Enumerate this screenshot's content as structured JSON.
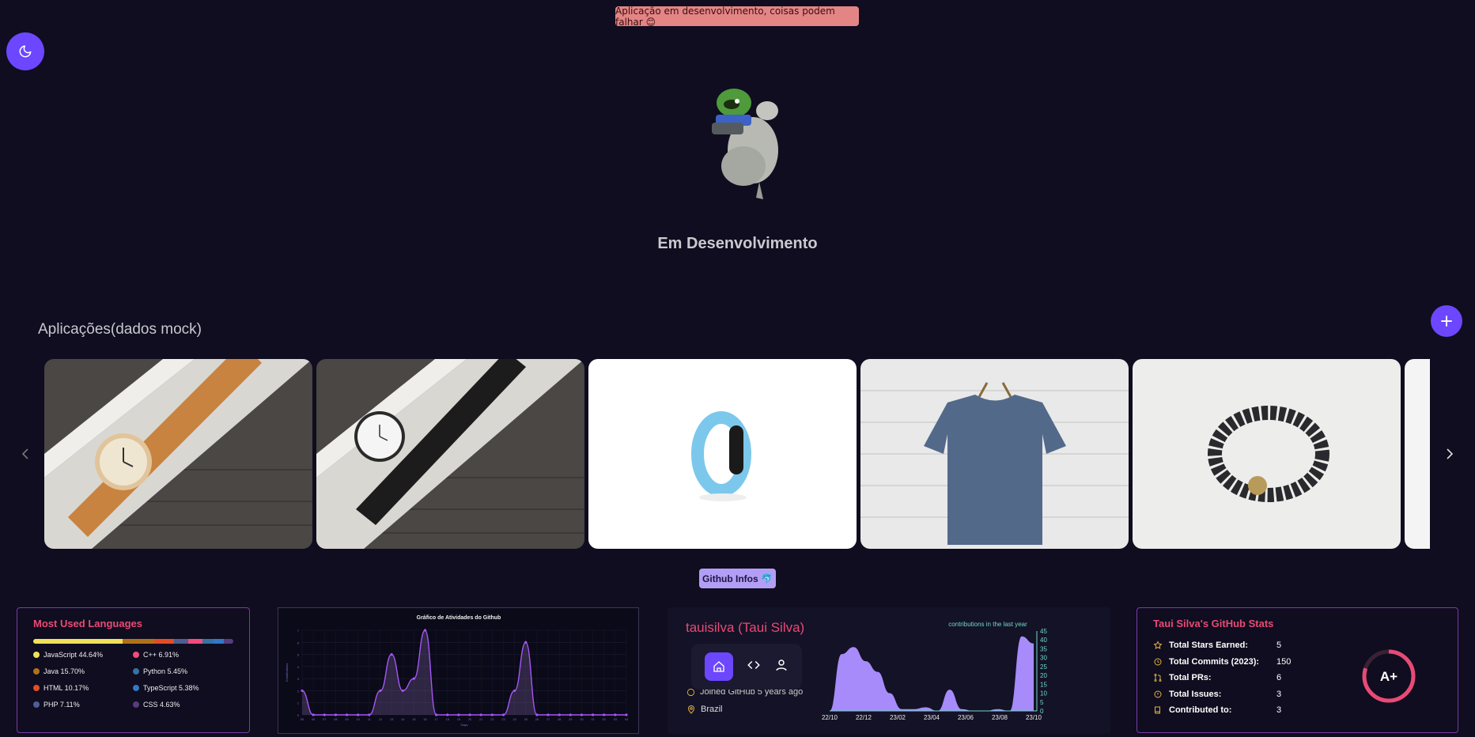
{
  "banner": {
    "text": "Aplicação em desenvolvimento, coisas podem falhar 😊"
  },
  "hero": {
    "title": "Em Desenvolvimento"
  },
  "apps": {
    "title": "Aplicações(dados mock)"
  },
  "github_badge": "Github Infos 🐬",
  "languages": {
    "title": "Most Used Languages",
    "items": [
      {
        "label": "JavaScript 44.64%",
        "color": "#f1e05a",
        "pct": 44.64
      },
      {
        "label": "C++ 6.91%",
        "color": "#f34b7d",
        "pct": 6.91
      },
      {
        "label": "Java 15.70%",
        "color": "#b07219",
        "pct": 15.7
      },
      {
        "label": "Python 5.45%",
        "color": "#3572A5",
        "pct": 5.45
      },
      {
        "label": "HTML 10.17%",
        "color": "#e34c26",
        "pct": 10.17
      },
      {
        "label": "TypeScript 5.38%",
        "color": "#3178c6",
        "pct": 5.38
      },
      {
        "label": "PHP 7.11%",
        "color": "#4F5D95",
        "pct": 7.11
      },
      {
        "label": "CSS 4.63%",
        "color": "#563d7c",
        "pct": 4.63
      }
    ]
  },
  "chart_data": [
    {
      "type": "area",
      "title": "Gráfico de Atividades do Github",
      "xlabel": "Days",
      "ylabel": "Contributions",
      "x": [
        "05",
        "06",
        "07",
        "08",
        "09",
        "10",
        "11",
        "12",
        "13",
        "14",
        "15",
        "16",
        "17",
        "18",
        "19",
        "20",
        "21",
        "22",
        "23",
        "24",
        "25",
        "26",
        "27",
        "28",
        "29",
        "30",
        "01",
        "02",
        "03",
        "04"
      ],
      "values": [
        2,
        0,
        0,
        0,
        0,
        0,
        0,
        2,
        5,
        2,
        3,
        7,
        0,
        0,
        0,
        0,
        0,
        0,
        0,
        2,
        6,
        0,
        0,
        0,
        0,
        0,
        0,
        0,
        0,
        0
      ],
      "ylim": [
        0,
        7
      ],
      "color": "#a855f7"
    },
    {
      "type": "area",
      "title": "contributions in the last year",
      "x": [
        "22/10",
        "22/12",
        "23/02",
        "23/04",
        "23/06",
        "23/08",
        "23/10"
      ],
      "values": [
        0,
        32,
        36,
        28,
        22,
        10,
        1,
        1,
        2,
        0,
        12,
        1,
        0,
        0,
        1,
        0,
        42,
        38
      ],
      "ylim": [
        0,
        45
      ],
      "yticks": [
        0,
        5,
        10,
        15,
        20,
        25,
        30,
        35,
        40,
        45
      ],
      "color": "#a78bfa"
    }
  ],
  "profile": {
    "name": "tauisilva (Taui Silva)",
    "joined": "Joined GitHub 5 years ago",
    "location": "Brazil"
  },
  "stats": {
    "title": "Taui Silva's GitHub Stats",
    "rows": [
      {
        "label": "Total Stars Earned:",
        "value": "5",
        "icon": "star-icon"
      },
      {
        "label": "Total Commits (2023):",
        "value": "150",
        "icon": "history-icon"
      },
      {
        "label": "Total PRs:",
        "value": "6",
        "icon": "pull-request-icon"
      },
      {
        "label": "Total Issues:",
        "value": "3",
        "icon": "issue-icon"
      },
      {
        "label": "Contributed to:",
        "value": "3",
        "icon": "repo-icon"
      }
    ],
    "grade": "A+",
    "grade_progress": 0.8
  },
  "colors": {
    "accent": "#6c47ff",
    "pink": "#e84a76",
    "background": "#0f0d1f"
  }
}
